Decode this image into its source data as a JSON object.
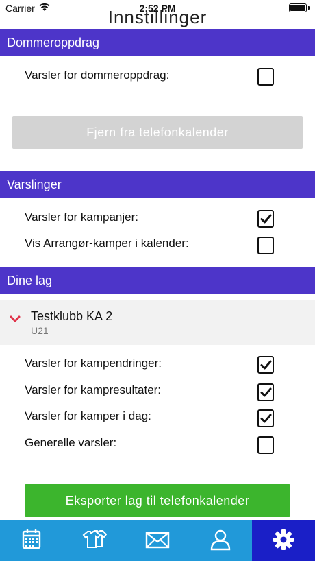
{
  "status_bar": {
    "carrier": "Carrier",
    "time": "2:52 PM"
  },
  "page_title": "Innstillinger",
  "sections": {
    "dommeroppdrag": {
      "header": "Dommeroppdrag",
      "rows": [
        {
          "label": "Varsler for dommeroppdrag:",
          "checked": false
        }
      ],
      "button_label": "Fjern fra telefonkalender"
    },
    "varslinger": {
      "header": "Varslinger",
      "rows": [
        {
          "label": "Varsler for kampanjer:",
          "checked": true
        },
        {
          "label": "Vis Arrangør-kamper i kalender:",
          "checked": false
        }
      ]
    },
    "dine_lag": {
      "header": "Dine lag",
      "team": {
        "name": "Testklubb KA 2",
        "subtitle": "U21"
      },
      "rows": [
        {
          "label": "Varsler for kampendringer:",
          "checked": true
        },
        {
          "label": "Varsler for kampresultater:",
          "checked": true
        },
        {
          "label": "Varsler for kamper i dag:",
          "checked": true
        },
        {
          "label": "Generelle varsler:",
          "checked": false
        }
      ],
      "button_label": "Eksporter lag til telefonkalender"
    }
  },
  "tab_bar": {
    "tabs": [
      {
        "icon": "calendar-icon",
        "active": false
      },
      {
        "icon": "jerseys-icon",
        "active": false
      },
      {
        "icon": "mail-icon",
        "active": false
      },
      {
        "icon": "user-icon",
        "active": false
      },
      {
        "icon": "gear-icon",
        "active": true
      }
    ]
  },
  "colors": {
    "header_bg": "#4d35c9",
    "tabbar_bg": "#2199d9",
    "tab_active_bg": "#1a1fc7",
    "export_button": "#3cb52d",
    "disabled_button": "#d3d3d3",
    "chevron": "#e0334a"
  }
}
